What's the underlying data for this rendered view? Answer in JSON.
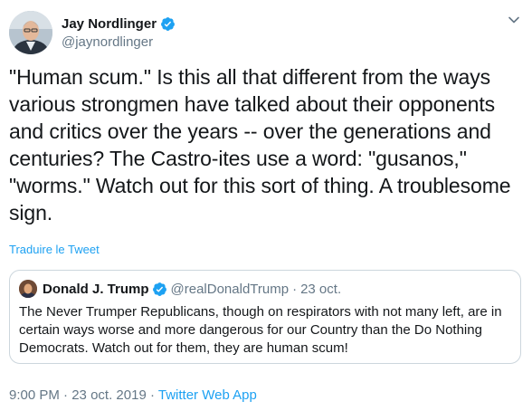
{
  "author": {
    "display_name": "Jay Nordlinger",
    "handle": "@jaynordlinger",
    "verified": true,
    "avatar_icon": "profile-photo"
  },
  "tweet": {
    "text": "\"Human scum.\" Is this all that different from the ways various strongmen have talked about their opponents and critics over the years -- over the generations and centuries? The Castro-ites use a word: \"gusanos,\" \"worms.\" Watch out for this sort of thing. A troublesome sign.",
    "translate_label": "Traduire le Tweet"
  },
  "quoted_tweet": {
    "display_name": "Donald J. Trump",
    "handle": "@realDonaldTrump",
    "separator": "·",
    "date": "23 oct.",
    "verified": true,
    "text": "The Never Trumper Republicans, though on respirators with not many left, are in certain ways worse and more dangerous for our Country than the Do Nothing Democrats. Watch out for them, they are human scum!"
  },
  "footer": {
    "time": "9:00 PM",
    "sep1": "·",
    "date": "23 oct. 2019",
    "sep2": "·",
    "source": "Twitter Web App"
  },
  "colors": {
    "accent": "#1da1f2",
    "secondary_text": "#657786",
    "border": "#ccd6dd"
  }
}
